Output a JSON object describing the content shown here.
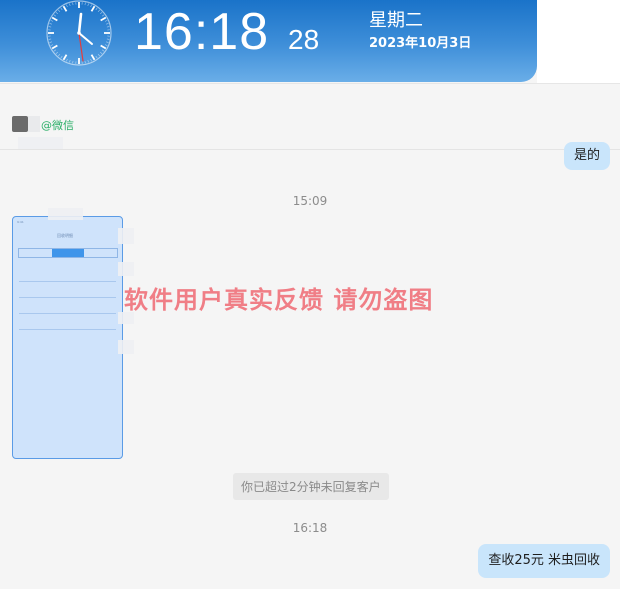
{
  "clock": {
    "time": "16:18",
    "seconds": "28",
    "weekday": "星期二",
    "date": "2023年10月3日"
  },
  "chat": {
    "contact_source": "@微信",
    "messages": {
      "reply_short": "是的",
      "timestamp_1": "15:09",
      "system_note": "你已超过2分钟未回复客户",
      "timestamp_2": "16:18",
      "reply_recycle": "查收25元 米虫回收"
    }
  },
  "screenshot_preview": {
    "tabs": [
      "",
      "",
      ""
    ]
  },
  "watermark": "软件用户真实反馈  请勿盗图",
  "colors": {
    "banner_top": "#1a73c9",
    "banner_bottom": "#6aaee8",
    "bubble_right": "#c9e5fb",
    "source_green": "#2aae67",
    "watermark": "#f07e86"
  },
  "icons": {
    "clock": "analog-clock-icon",
    "avatar": "contact-avatar"
  }
}
